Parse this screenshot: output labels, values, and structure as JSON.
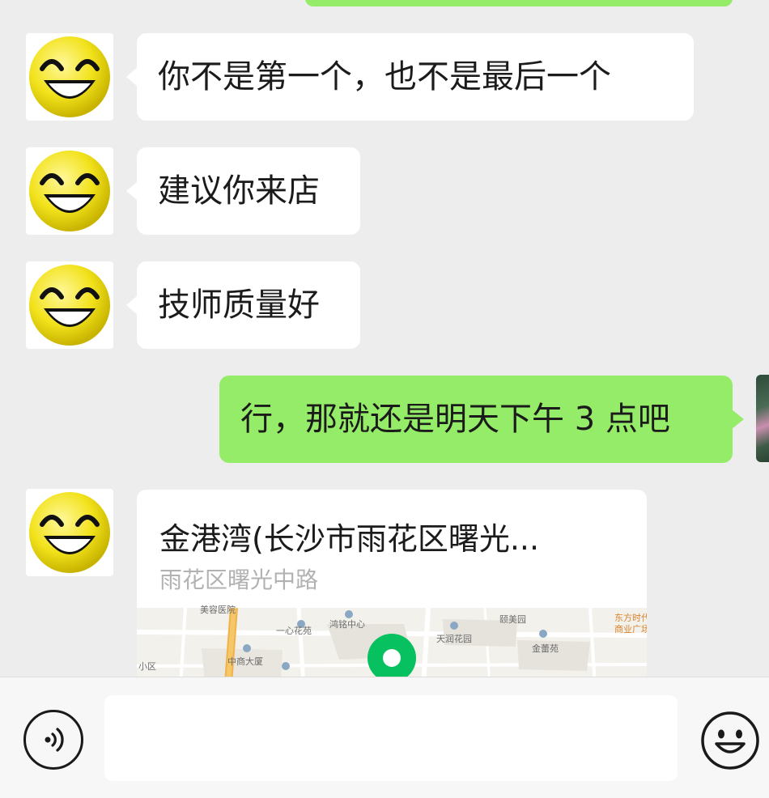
{
  "messages": [
    {
      "side": "left",
      "text": "你不是第一个，也不是最后一个"
    },
    {
      "side": "left",
      "text": "建议你来店"
    },
    {
      "side": "left",
      "text": "技师质量好"
    },
    {
      "side": "right",
      "text": "行，那就还是明天下午 3 点吧"
    }
  ],
  "location_card": {
    "title": "金港湾(长沙市雨花区曙光...",
    "address": "雨花区曙光中路",
    "map_labels": [
      "美容医院",
      "一心花苑",
      "鸿铭中心",
      "颐美园",
      "东方时代",
      "商业广场",
      "天润花园",
      "金蕾苑",
      "中商大厦",
      "小区"
    ]
  },
  "input_bar": {
    "voice_icon": "voice-icon",
    "emoji_icon": "emoji-icon",
    "placeholder": ""
  },
  "colors": {
    "background": "#ededed",
    "incoming_bubble": "#ffffff",
    "outgoing_bubble": "#95ec69",
    "map_pin": "#07c160"
  }
}
